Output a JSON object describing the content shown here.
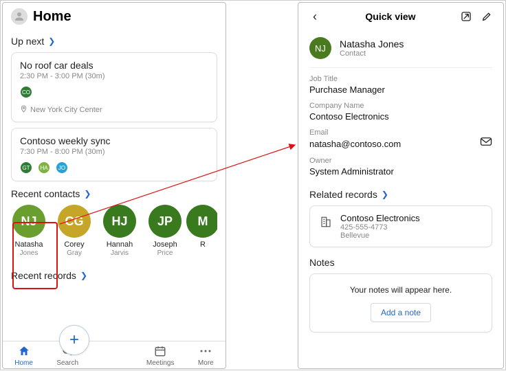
{
  "home": {
    "title": "Home",
    "upnext": {
      "label": "Up next",
      "items": [
        {
          "title": "No roof car deals",
          "time": "2:30 PM - 3:00 PM (30m)",
          "attendees": [
            {
              "initials": "CO",
              "color": "#2e7d32"
            }
          ],
          "location_icon": "pin-icon",
          "location": "New York City Center"
        },
        {
          "title": "Contoso weekly sync",
          "time": "7:30 PM - 8:00 PM (30m)",
          "attendees": [
            {
              "initials": "GT",
              "color": "#2e7d32"
            },
            {
              "initials": "HA",
              "color": "#7cb342"
            },
            {
              "initials": "JO",
              "color": "#29a3d6"
            }
          ]
        }
      ]
    },
    "recent_contacts": {
      "label": "Recent contacts",
      "items": [
        {
          "initials": "NJ",
          "first": "Natasha",
          "last": "Jones",
          "color": "#6a9e2e"
        },
        {
          "initials": "CG",
          "first": "Corey",
          "last": "Gray",
          "color": "#c5a629"
        },
        {
          "initials": "HJ",
          "first": "Hannah",
          "last": "Jarvis",
          "color": "#3a7a1e"
        },
        {
          "initials": "JP",
          "first": "Joseph",
          "last": "Price",
          "color": "#3a7a1e"
        },
        {
          "initials": "M",
          "first": "R",
          "last": "",
          "color": "#3a7a1e"
        }
      ]
    },
    "recent_records": {
      "label": "Recent records"
    },
    "tabs": {
      "home": "Home",
      "search": "Search",
      "meetings": "Meetings",
      "more": "More"
    }
  },
  "quickview": {
    "title": "Quick view",
    "person": {
      "initials": "NJ",
      "name": "Natasha Jones",
      "type": "Contact"
    },
    "fields": {
      "job_title_label": "Job Title",
      "job_title": "Purchase Manager",
      "company_label": "Company Name",
      "company": "Contoso Electronics",
      "email_label": "Email",
      "email": "natasha@contoso.com",
      "owner_label": "Owner",
      "owner": "System Administrator"
    },
    "related": {
      "label": "Related records",
      "item": {
        "title": "Contoso Electronics",
        "phone": "425-555-4773",
        "city": "Bellevue"
      }
    },
    "notes": {
      "label": "Notes",
      "placeholder": "Your notes will appear here.",
      "add": "Add a note"
    }
  }
}
